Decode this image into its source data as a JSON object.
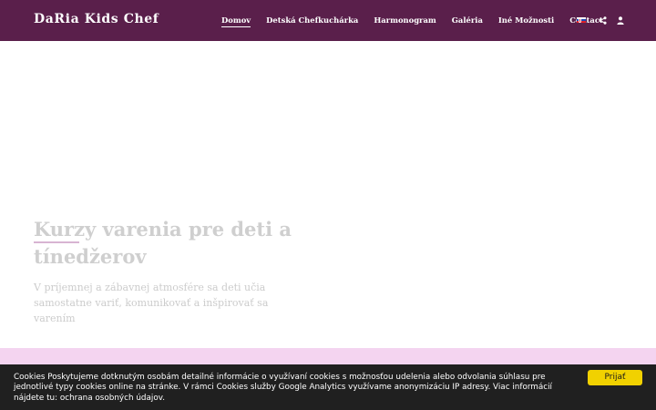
{
  "header": {
    "brand": "DaRia Kids Chef",
    "nav": [
      {
        "label": "Domov",
        "active": true
      },
      {
        "label": "Detská Chefkuchárka",
        "active": false
      },
      {
        "label": "Harmonogram",
        "active": false
      },
      {
        "label": "Galéria",
        "active": false
      },
      {
        "label": "Iné Možnosti",
        "active": false
      },
      {
        "label": "Contact",
        "active": false
      }
    ],
    "icons": [
      "slovak-flag-icon",
      "share-icon",
      "user-icon"
    ],
    "background_color": "#5a1f4b"
  },
  "hero": {
    "title": "Kurzy varenia pre deti a tínedžerov",
    "subtitle": "V príjemnej a zábavnej atmosfére sa deti učia samostatne variť, komunikovať a inšpirovať sa varením"
  },
  "cookie_banner": {
    "text": "Cookies Poskytujeme dotknutým osobám detailné informácie o využívaní cookies s možnosťou udelenia alebo odvolania súhlasu pre jednotlivé typy cookies online na stránke. V rámci Cookies služby Google Analytics využívame anonymizáciu IP adresy. Viac informácií nájdete tu: ochrana osobných údajov.",
    "accept_label": "Prijať",
    "button_color": "#f1d100"
  }
}
